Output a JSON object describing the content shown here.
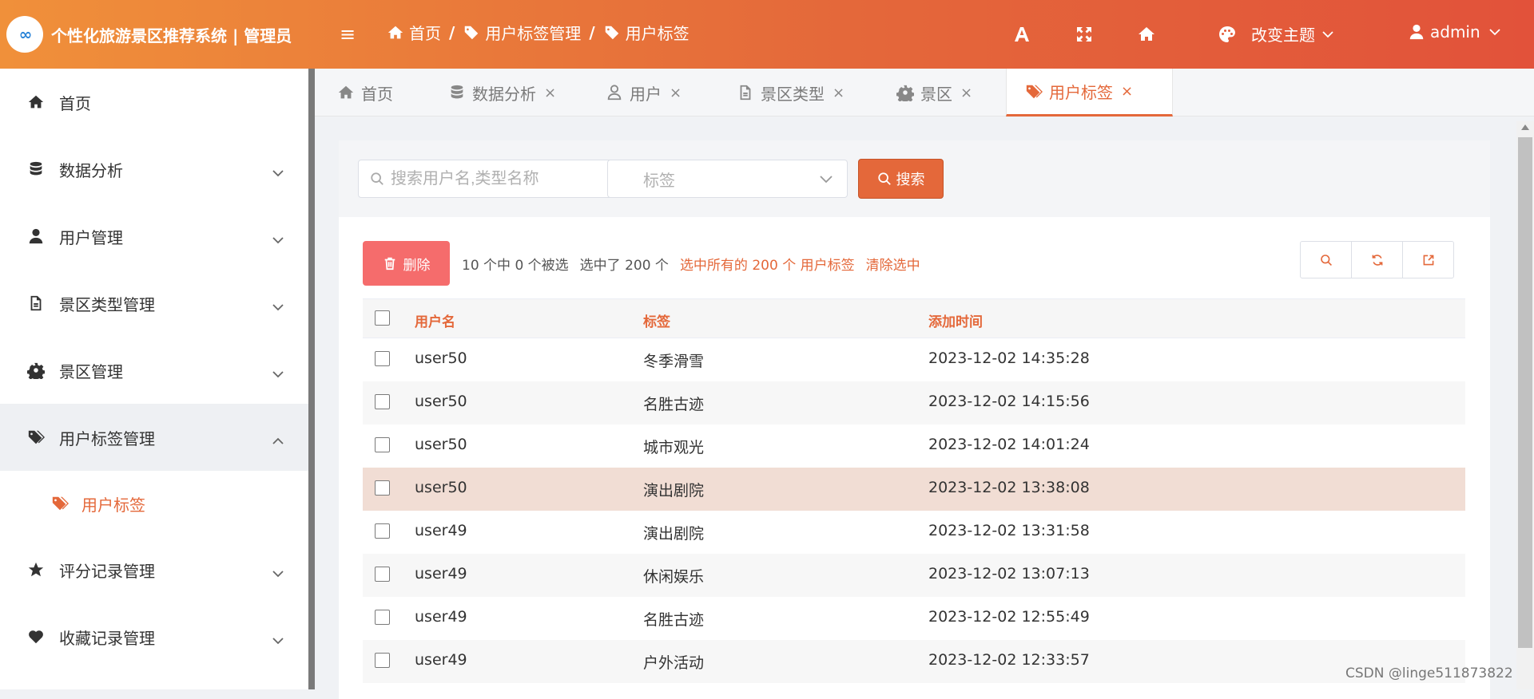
{
  "app": {
    "title": "个性化旅游景区推荐系统 | 管理员",
    "logo_text": "∞"
  },
  "colors": {
    "accent": "#e4683a",
    "header_start": "#f0903a",
    "header_end": "#e2523a",
    "danger": "#f56c6c",
    "highlight_row": "#f1ddd4"
  },
  "breadcrumb": [
    {
      "label": "首页",
      "icon": "home-icon"
    },
    {
      "label": "用户标签管理",
      "icon": "tags-icon"
    },
    {
      "label": "用户标签",
      "icon": "tags-icon"
    }
  ],
  "breadcrumb_sep": "/",
  "header": {
    "icons": [
      "font-size-icon",
      "fullscreen-icon",
      "home-icon"
    ],
    "theme_label": "改变主题",
    "user_label": "admin"
  },
  "sidebar": {
    "items": [
      {
        "label": "首页",
        "icon": "home-icon",
        "has_arrow": false
      },
      {
        "label": "数据分析",
        "icon": "database-icon",
        "has_arrow": true
      },
      {
        "label": "用户管理",
        "icon": "user-icon",
        "has_arrow": true
      },
      {
        "label": "景区类型管理",
        "icon": "file-icon",
        "has_arrow": true
      },
      {
        "label": "景区管理",
        "icon": "gear-icon",
        "has_arrow": true
      },
      {
        "label": "用户标签管理",
        "icon": "tags-icon",
        "has_arrow": true,
        "expanded": true
      },
      {
        "label": "评分记录管理",
        "icon": "star-icon",
        "has_arrow": true
      },
      {
        "label": "收藏记录管理",
        "icon": "heart-icon",
        "has_arrow": true
      }
    ],
    "sub_item": {
      "label": "用户标签",
      "icon": "tags-icon"
    }
  },
  "tabs": [
    {
      "label": "首页",
      "icon": "home-icon",
      "closable": false
    },
    {
      "label": "数据分析",
      "icon": "database-icon",
      "closable": true
    },
    {
      "label": "用户",
      "icon": "user-icon",
      "closable": true
    },
    {
      "label": "景区类型",
      "icon": "file-icon",
      "closable": true
    },
    {
      "label": "景区",
      "icon": "gear-icon",
      "closable": true
    },
    {
      "label": "用户标签",
      "icon": "tags-icon",
      "closable": true,
      "active": true
    }
  ],
  "tab_close": "×",
  "filters": {
    "search_placeholder": "搜索用户名,类型名称",
    "tag_placeholder": "标签",
    "search_button": "搜索"
  },
  "actions": {
    "delete_button": "删除",
    "selection_count": "10 个中 0 个被选",
    "selected_total": "选中了 200 个",
    "select_all_link": "选中所有的 200 个 用户标签",
    "clear_link": "清除选中"
  },
  "table": {
    "columns": [
      "用户名",
      "标签",
      "添加时间"
    ],
    "rows": [
      {
        "user": "user50",
        "tag": "冬季滑雪",
        "time": "2023-12-02 14:35:28"
      },
      {
        "user": "user50",
        "tag": "名胜古迹",
        "time": "2023-12-02 14:15:56"
      },
      {
        "user": "user50",
        "tag": "城市观光",
        "time": "2023-12-02 14:01:24"
      },
      {
        "user": "user50",
        "tag": "演出剧院",
        "time": "2023-12-02 13:38:08"
      },
      {
        "user": "user49",
        "tag": "演出剧院",
        "time": "2023-12-02 13:31:58"
      },
      {
        "user": "user49",
        "tag": "休闲娱乐",
        "time": "2023-12-02 13:07:13"
      },
      {
        "user": "user49",
        "tag": "名胜古迹",
        "time": "2023-12-02 12:55:49"
      },
      {
        "user": "user49",
        "tag": "户外活动",
        "time": "2023-12-02 12:33:57"
      }
    ]
  },
  "watermark": "CSDN @linge511873822"
}
